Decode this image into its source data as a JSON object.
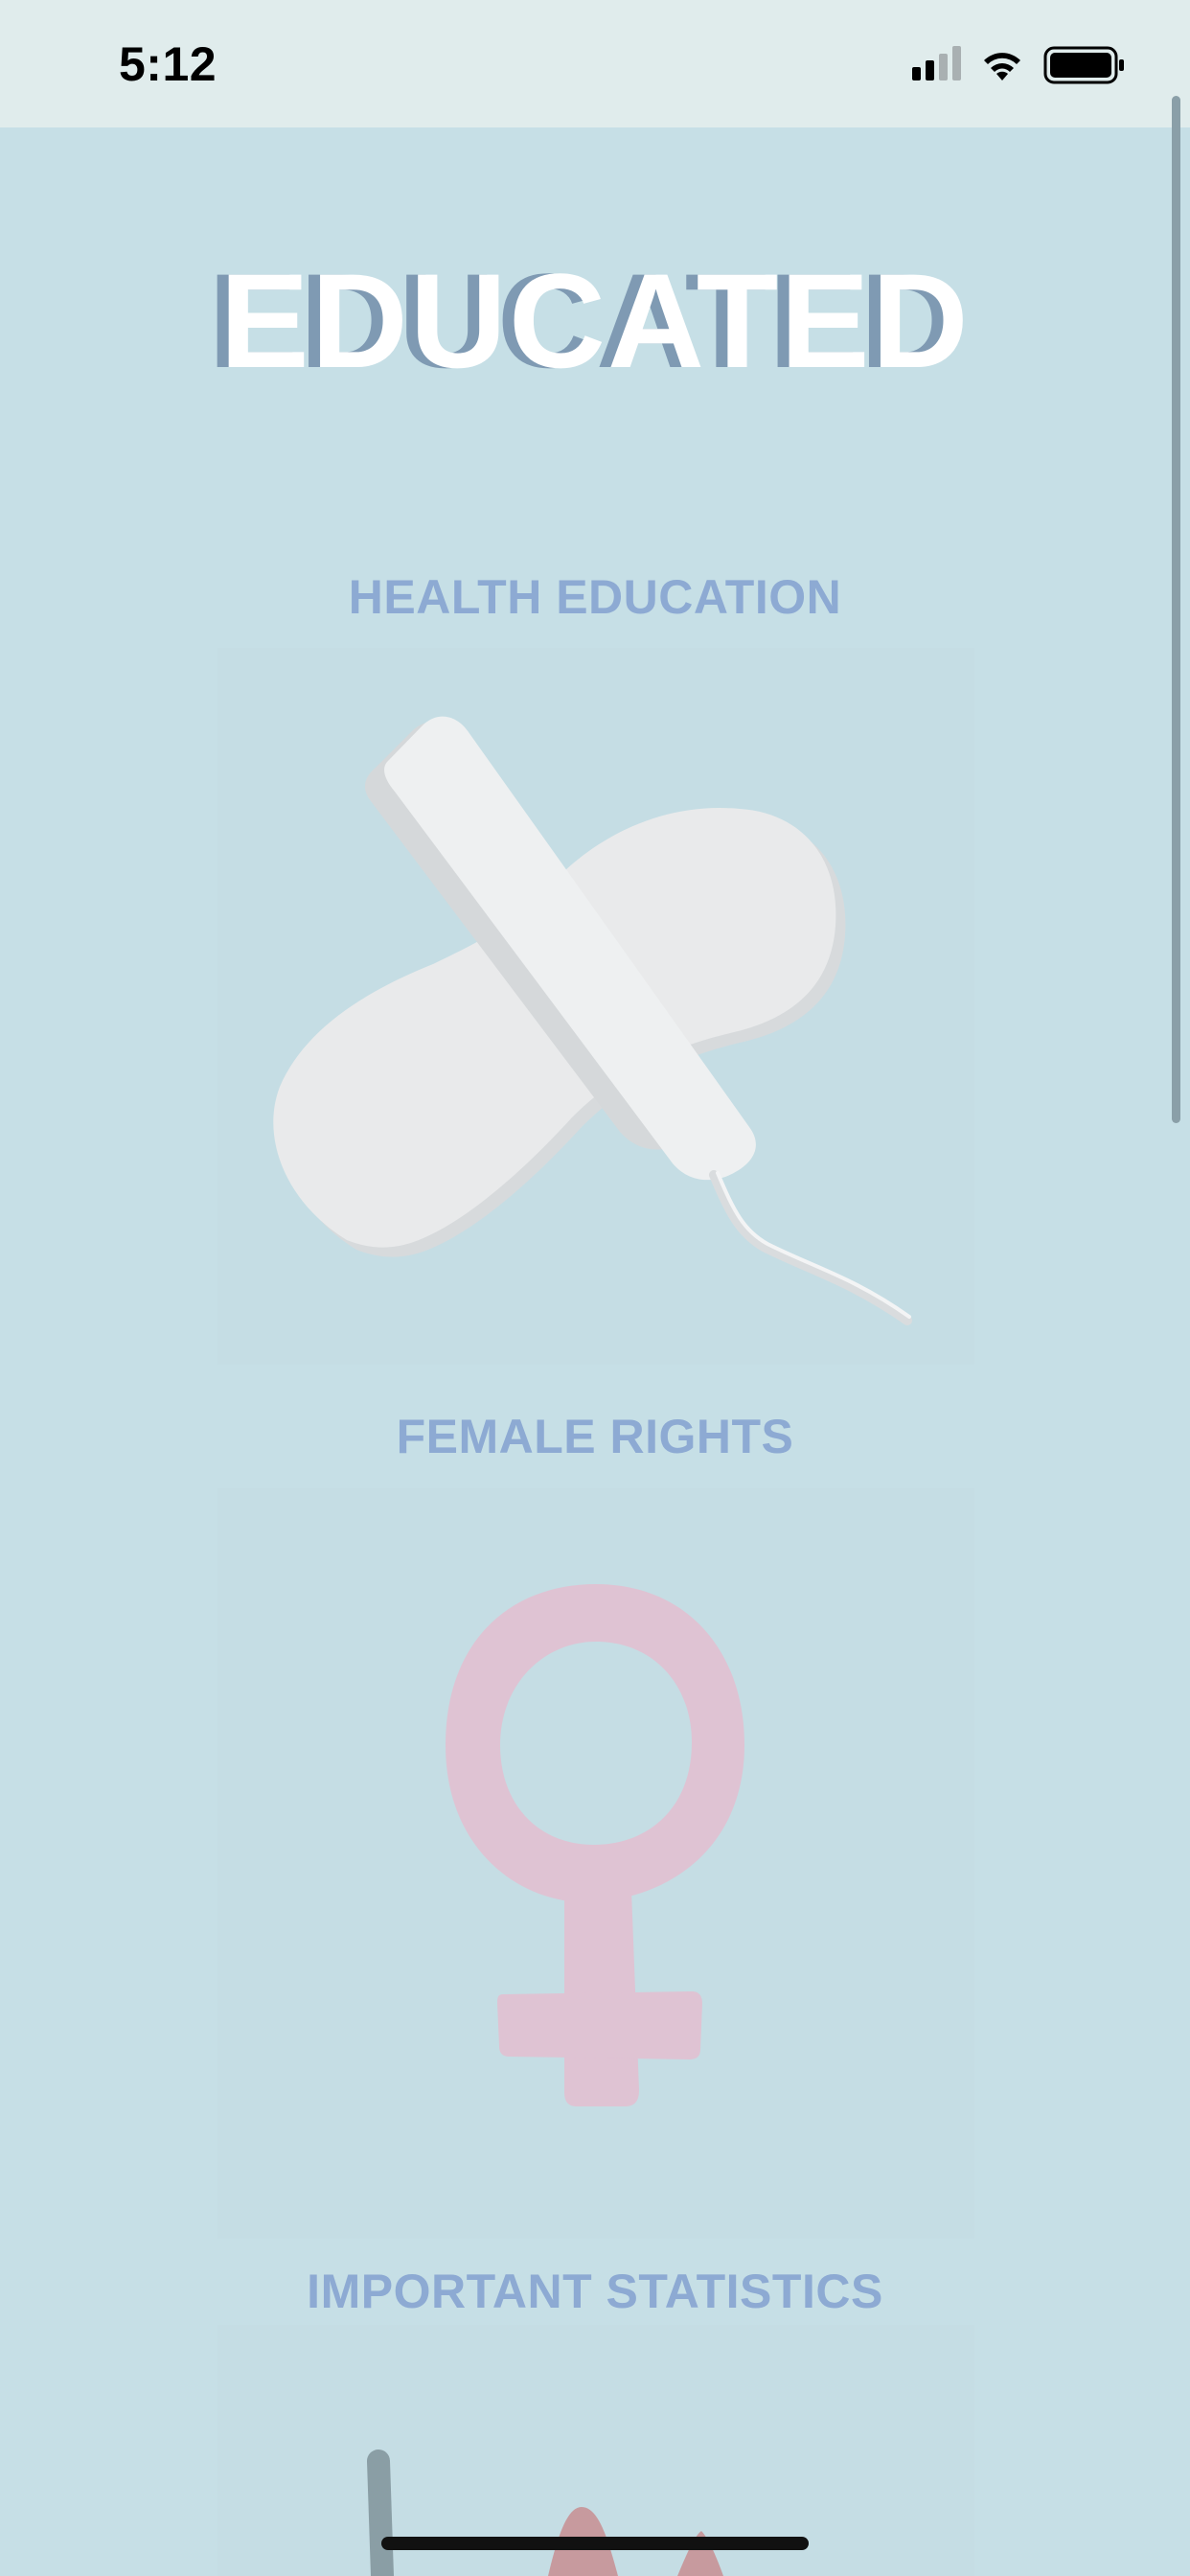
{
  "status_bar": {
    "time": "5:12",
    "signal_icon": "cellular-signal-icon",
    "wifi_icon": "wifi-icon",
    "battery_icon": "battery-icon"
  },
  "app": {
    "title": "EDUCATED"
  },
  "sections": [
    {
      "title": "HEALTH EDUCATION",
      "icon": "tampon-pad-icon"
    },
    {
      "title": "FEMALE RIGHTS",
      "icon": "female-symbol-icon"
    },
    {
      "title": "IMPORTANT STATISTICS",
      "icon": "chart-icon"
    }
  ],
  "colors": {
    "background": "#c6dfe6",
    "section_title": "#8daad3",
    "title_shadow": "#7f9ab3",
    "female_symbol": "#dfc3d3"
  }
}
